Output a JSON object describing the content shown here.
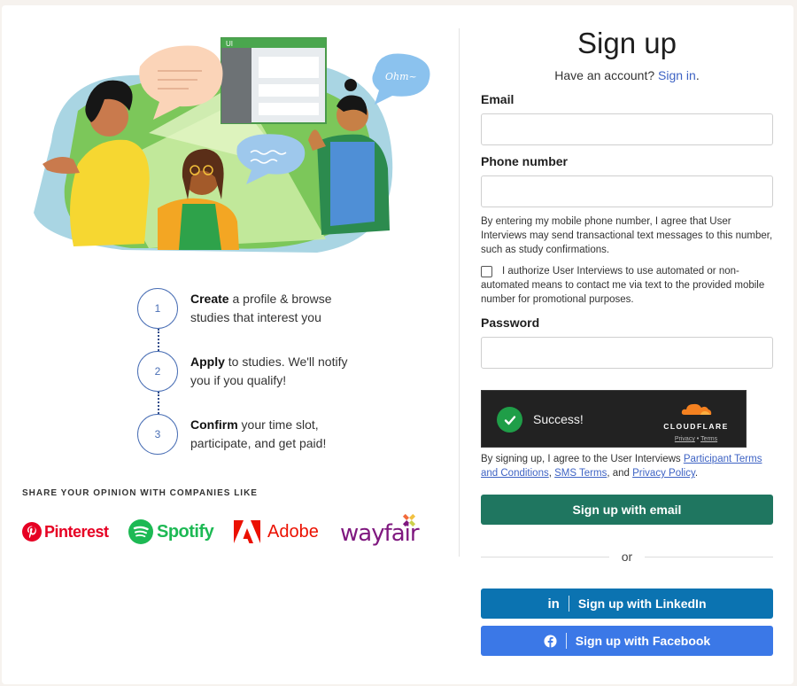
{
  "steps": [
    {
      "number": "1",
      "bold": "Create",
      "rest": " a profile & browse studies that interest you"
    },
    {
      "number": "2",
      "bold": "Apply",
      "rest": " to studies. We'll notify you if you qualify!"
    },
    {
      "number": "3",
      "bold": "Confirm",
      "rest": " your time slot, participate, and get paid!"
    }
  ],
  "share_label": "SHARE YOUR OPINION WITH COMPANIES LIKE",
  "logos": {
    "pinterest": "Pinterest",
    "spotify": "Spotify",
    "adobe": "Adobe",
    "wayfair": "wayfair"
  },
  "illustration": {
    "app_badge": "UI",
    "bubble_text": "Ohm~"
  },
  "form": {
    "title": "Sign up",
    "have_account": "Have an account?",
    "sign_in": "Sign in",
    "sign_in_suffix": ".",
    "email_label": "Email",
    "email_value": "",
    "phone_label": "Phone number",
    "phone_value": "",
    "phone_disclaimer": "By entering my mobile phone number, I agree that User Interviews may send transactional text messages to this number, such as study confirmations.",
    "consent_text": "I authorize User Interviews to use automated or non-automated means to contact me via text to the provided mobile number for promotional purposes.",
    "password_label": "Password",
    "password_value": "",
    "captcha": {
      "status": "Success!",
      "brand": "CLOUDFLARE",
      "privacy": "Privacy",
      "dot": "•",
      "terms": "Terms"
    },
    "terms_prefix": "By signing up, I agree to the User Interviews ",
    "terms_link1": "Participant Terms and Conditions",
    "terms_sep1": ", ",
    "terms_link2": "SMS Terms",
    "terms_sep2": ", and ",
    "terms_link3": "Privacy Policy",
    "terms_suffix": ".",
    "signup_email": "Sign up with email",
    "or": "or",
    "linkedin_icon_text": "in",
    "signup_linkedin": "Sign up with LinkedIn",
    "signup_facebook": "Sign up with Facebook"
  },
  "colors": {
    "primary_green": "#1f7660",
    "linkedin_blue": "#0b73b1",
    "facebook_blue": "#3b78e7",
    "link_blue": "#3e63c4"
  }
}
